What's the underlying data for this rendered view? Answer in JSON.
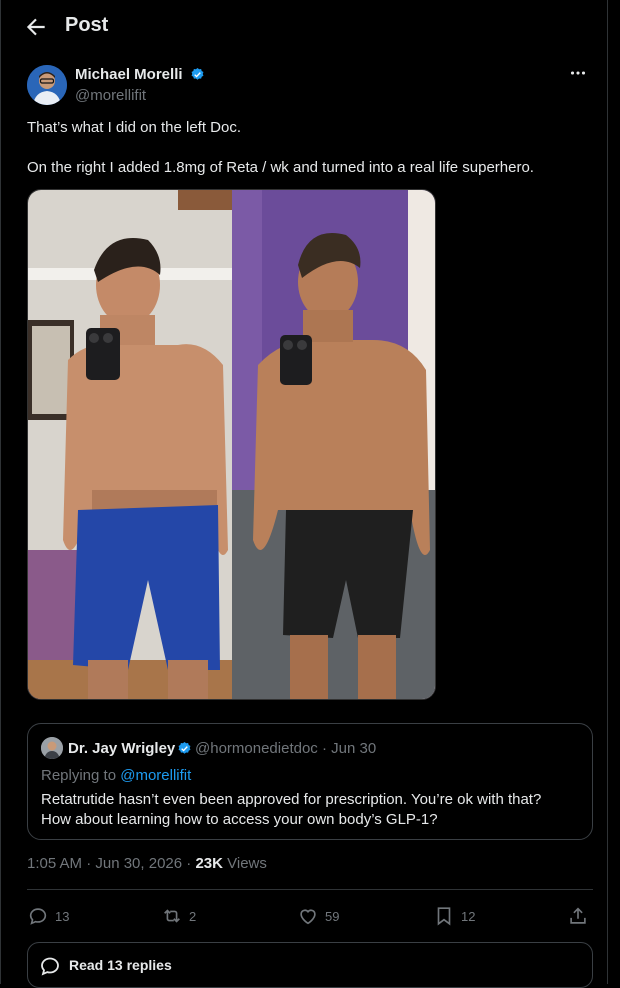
{
  "header": {
    "title": "Post",
    "back_icon": "arrow-left-icon"
  },
  "post": {
    "author": {
      "name": "Michael Morelli",
      "handle": "@morellifit",
      "verified": true
    },
    "text_lines": [
      "That’s what I did on the left Doc.",
      "On the right I added 1.8mg of Reta / wk and turned into a real life superhero."
    ],
    "media_alt": "before-after-photo",
    "more_icon": "ellipsis-icon"
  },
  "quote": {
    "name": "Dr. Jay Wrigley",
    "handle": "@hormonedietdoc",
    "separator": "·",
    "date": "Jun 30",
    "replying_prefix": "Replying to",
    "replying_to": "@morellifit",
    "text_lines": [
      "Retatrutide hasn’t even been approved for prescription. You’re ok with that?",
      "How about learning how to access your own body’s GLP-1?"
    ]
  },
  "meta": {
    "time": "1:05 AM · Jun 30, 2026 · ",
    "views": "23K",
    "views_label": " Views"
  },
  "actions": {
    "replies": "13",
    "reposts": "2",
    "likes": "59",
    "bookmarks": "12"
  },
  "read_replies": {
    "label": "Read 13 replies"
  },
  "colors": {
    "background": "#000000",
    "text": "#e7e9ea",
    "muted": "#71767b",
    "accent": "#1d9bf0",
    "border": "#2f3336"
  }
}
